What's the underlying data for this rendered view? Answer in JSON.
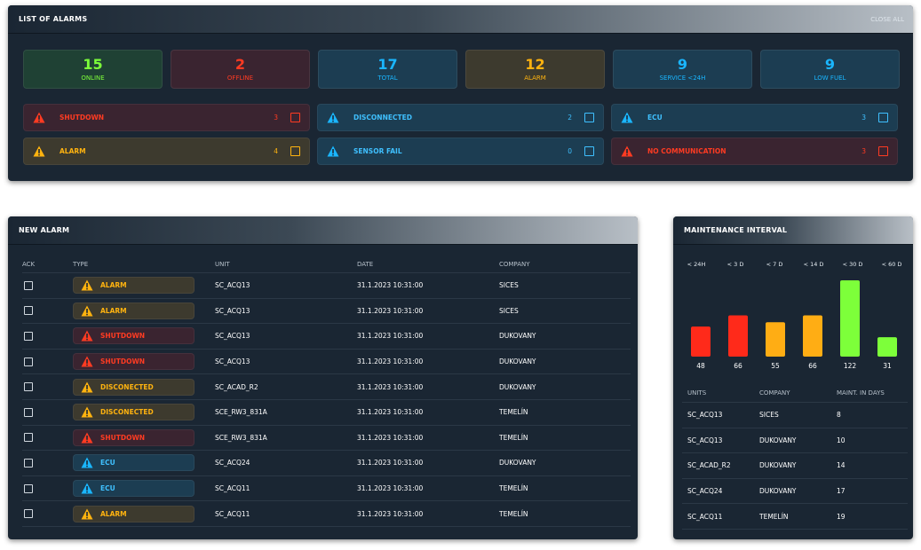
{
  "alarms_panel": {
    "title": "LIST OF ALARMS",
    "close_all": "CLOSE ALL",
    "stats": [
      {
        "value": "15",
        "label": "ONLINE",
        "color": "green"
      },
      {
        "value": "2",
        "label": "OFFLINE",
        "color": "red"
      },
      {
        "value": "17",
        "label": "TOTAL",
        "color": "blue"
      },
      {
        "value": "12",
        "label": "ALARM",
        "color": "orange"
      },
      {
        "value": "9",
        "label": "SERVICE <24H",
        "color": "blue"
      },
      {
        "value": "9",
        "label": "LOW FUEL",
        "color": "blue"
      }
    ],
    "categories": [
      {
        "label": "SHUTDOWN",
        "count": "3",
        "color": "red"
      },
      {
        "label": "DISCONNECTED",
        "count": "2",
        "color": "blue"
      },
      {
        "label": "ECU",
        "count": "3",
        "color": "blue"
      },
      {
        "label": "ALARM",
        "count": "4",
        "color": "orange"
      },
      {
        "label": "SENSOR FAIL",
        "count": "0",
        "color": "blue"
      },
      {
        "label": "NO COMMUNICATION",
        "count": "3",
        "color": "red"
      }
    ]
  },
  "new_alarm": {
    "title": "NEW ALARM",
    "columns": [
      "ACK",
      "TYPE",
      "UNIT",
      "DATE",
      "COMPANY"
    ],
    "rows": [
      {
        "type": "ALARM",
        "color": "orange",
        "unit": "SC_ACQ13",
        "date": "31.1.2023 10:31:00",
        "company": "SICES"
      },
      {
        "type": "ALARM",
        "color": "orange",
        "unit": "SC_ACQ13",
        "date": "31.1.2023 10:31:00",
        "company": "SICES"
      },
      {
        "type": "SHUTDOWN",
        "color": "red",
        "unit": "SC_ACQ13",
        "date": "31.1.2023 10:31:00",
        "company": "DUKOVANY"
      },
      {
        "type": "SHUTDOWN",
        "color": "red",
        "unit": "SC_ACQ13",
        "date": "31.1.2023 10:31:00",
        "company": "DUKOVANY"
      },
      {
        "type": "DISCONECTED",
        "color": "orange",
        "unit": "SC_ACAD_R2",
        "date": "31.1.2023 10:31:00",
        "company": "DUKOVANY"
      },
      {
        "type": "DISCONECTED",
        "color": "orange",
        "unit": "SCE_RW3_831A",
        "date": "31.1.2023 10:31:00",
        "company": "TEMELÍN"
      },
      {
        "type": "SHUTDOWN",
        "color": "red",
        "unit": "SCE_RW3_831A",
        "date": "31.1.2023 10:31:00",
        "company": "TEMELÍN"
      },
      {
        "type": "ECU",
        "color": "blue",
        "unit": "SC_ACQ24",
        "date": "31.1.2023 10:31:00",
        "company": "DUKOVANY"
      },
      {
        "type": "ECU",
        "color": "blue",
        "unit": "SC_ACQ11",
        "date": "31.1.2023 10:31:00",
        "company": "TEMELÍN"
      },
      {
        "type": "ALARM",
        "color": "orange",
        "unit": "SC_ACQ11",
        "date": "31.1.2023 10:31:00",
        "company": "TEMELÍN"
      }
    ]
  },
  "maintenance": {
    "title": "MAINTENANCE INTERVAL",
    "columns": [
      "UNITS",
      "COMPANY",
      "MAINT. IN DAYS"
    ],
    "rows": [
      {
        "unit": "SC_ACQ13",
        "company": "SICES",
        "days": "8"
      },
      {
        "unit": "SC_ACQ13",
        "company": "DUKOVANY",
        "days": "10"
      },
      {
        "unit": "SC_ACAD_R2",
        "company": "DUKOVANY",
        "days": "14"
      },
      {
        "unit": "SC_ACQ24",
        "company": "DUKOVANY",
        "days": "17"
      },
      {
        "unit": "SC_ACQ11",
        "company": "TEMELÍN",
        "days": "19"
      }
    ]
  },
  "chart_data": {
    "type": "bar",
    "categories": [
      "< 24H",
      "< 3 D",
      "< 7 D",
      "< 14 D",
      "< 30 D",
      "< 60 D"
    ],
    "values": [
      48,
      66,
      55,
      66,
      122,
      31
    ],
    "colors": [
      "#ff2a1a",
      "#ff2a1a",
      "#ffad14",
      "#ffad14",
      "#7dff3a",
      "#7dff3a"
    ],
    "title": "",
    "xlabel": "",
    "ylabel": ""
  },
  "colors": {
    "green": "#7dff3a",
    "red": "#ff3b22",
    "blue": "#1ab6ff",
    "orange": "#ffb30f",
    "panel": "#1a2633"
  }
}
